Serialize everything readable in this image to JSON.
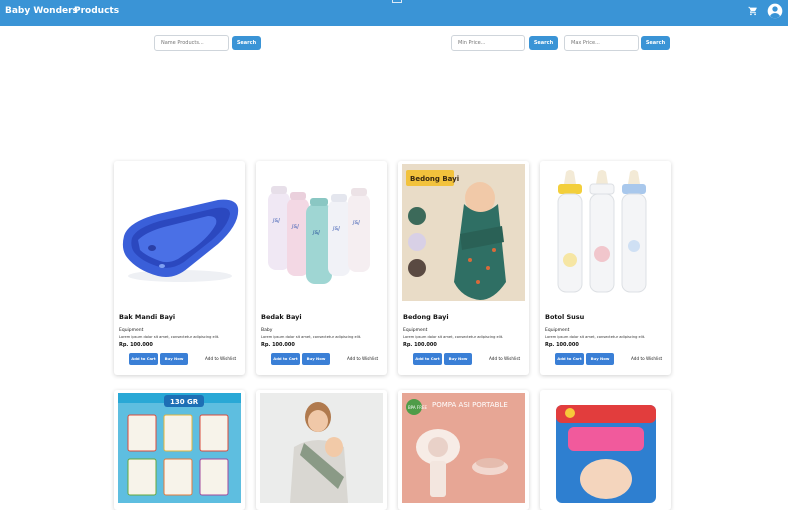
{
  "navbar": {
    "brand": "Baby Wonders",
    "link": "Products",
    "color": "#3a94d6"
  },
  "search": {
    "name_placeholder": "Name Products...",
    "search_label": "Search",
    "min_placeholder": "Min Price...",
    "max_placeholder": "Max Price..."
  },
  "products": [
    {
      "name": "Bak Mandi Bayi",
      "category": "Equipment",
      "description": "Lorem ipsum dolor sit amet, consectetur adipiscing elit.",
      "price": "Rp. 100.000",
      "add_to_cart": "Add to Cart",
      "buy_now": "Buy Now",
      "wishlist": "Add to Wishlist",
      "image": "baby-bathtub"
    },
    {
      "name": "Bedak Bayi",
      "category": "Baby",
      "description": "Lorem ipsum dolor sit amet, consectetur adipiscing elit.",
      "price": "Rp. 100.000",
      "add_to_cart": "Add to Cart",
      "buy_now": "Buy Now",
      "wishlist": "Add to Wishlist",
      "image": "baby-powder"
    },
    {
      "name": "Bedong Bayi",
      "category": "Equipment",
      "description": "Lorem ipsum dolor sit amet, consectetur adipiscing elit.",
      "price": "Rp. 100.000",
      "add_to_cart": "Add to Cart",
      "buy_now": "Buy Now",
      "wishlist": "Add to Wishlist",
      "image": "swaddle",
      "image_caption": "Bedong Bayi"
    },
    {
      "name": "Botol Susu",
      "category": "Equipment",
      "description": "Lorem ipsum dolor sit amet, consectetur adipiscing elit.",
      "price": "Rp. 100.000",
      "add_to_cart": "Add to Cart",
      "buy_now": "Buy Now",
      "wishlist": "Add to Wishlist",
      "image": "milk-bottles"
    }
  ],
  "partial_products": [
    {
      "image": "milna-baby-food",
      "banner": "130 GR"
    },
    {
      "image": "baby-carrier"
    },
    {
      "image": "breast-pump",
      "banner": "POMPA ASI PORTABLE",
      "badge": "BPA FREE"
    },
    {
      "image": "mamypoko-diapers"
    }
  ]
}
